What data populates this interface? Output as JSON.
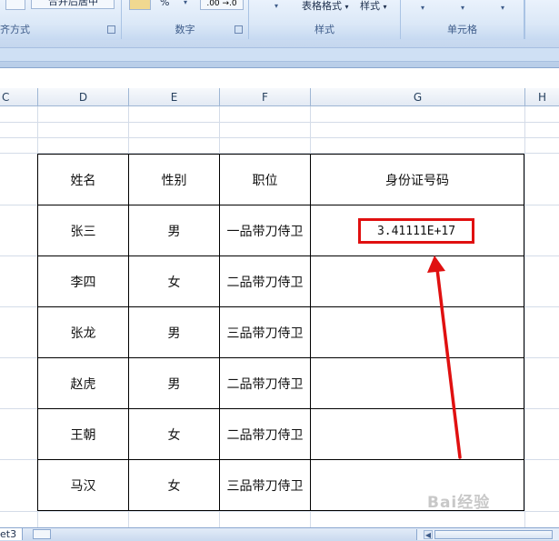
{
  "ribbon": {
    "groups": [
      {
        "label": "齐方式",
        "button": "合并后居中"
      },
      {
        "label": "数字",
        "button": "%"
      },
      {
        "label": "样式",
        "buttons": [
          "表格格式",
          "样式"
        ]
      },
      {
        "label": "单元格"
      }
    ],
    "number_format": ".00 →.0"
  },
  "columns": [
    "C",
    "D",
    "E",
    "F",
    "G",
    "H"
  ],
  "table": {
    "headers": [
      "姓名",
      "性别",
      "职位",
      "身份证号码"
    ],
    "rows": [
      [
        "张三",
        "男",
        "一品带刀侍卫",
        "3.41111E+17"
      ],
      [
        "李四",
        "女",
        "二品带刀侍卫",
        ""
      ],
      [
        "张龙",
        "男",
        "三品带刀侍卫",
        ""
      ],
      [
        "赵虎",
        "男",
        "二品带刀侍卫",
        ""
      ],
      [
        "王朝",
        "女",
        "二品带刀侍卫",
        ""
      ],
      [
        "马汉",
        "女",
        "三品带刀侍卫",
        ""
      ]
    ]
  },
  "annotation": {
    "color": "#e01010"
  },
  "sheet_tabs": {
    "current": "et3"
  },
  "watermark": "Bai经验"
}
